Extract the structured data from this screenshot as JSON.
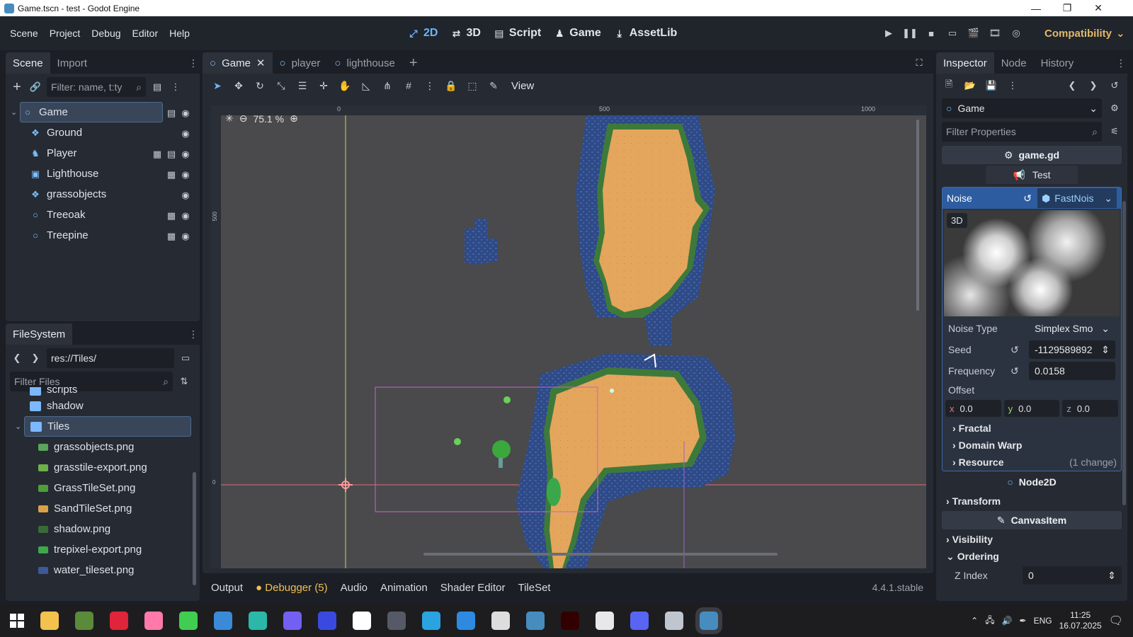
{
  "window": {
    "title": "Game.tscn - test - Godot Engine",
    "min": "—",
    "max": "❐",
    "close": "✕"
  },
  "menu": [
    "Scene",
    "Project",
    "Debug",
    "Editor",
    "Help"
  ],
  "workspaces": [
    {
      "label": "2D",
      "icon": "2d-icon",
      "glyph": "⤢",
      "active": true
    },
    {
      "label": "3D",
      "icon": "3d-icon",
      "glyph": "⇄",
      "active": false
    },
    {
      "label": "Script",
      "icon": "script-icon",
      "glyph": "▤",
      "active": false
    },
    {
      "label": "Game",
      "icon": "game-icon",
      "glyph": "♟",
      "active": false
    },
    {
      "label": "AssetLib",
      "icon": "assetlib-icon",
      "glyph": "⤓",
      "active": false
    }
  ],
  "renderer": "Compatibility",
  "scene_dock": {
    "tabs": [
      "Scene",
      "Import"
    ],
    "filter_placeholder": "Filter: name, t:ty",
    "nodes": [
      {
        "name": "Game",
        "depth": 0,
        "icon": "node2d-icon",
        "glyph": "○",
        "script": true,
        "movie": false,
        "selected": true
      },
      {
        "name": "Ground",
        "depth": 1,
        "icon": "tilemap-icon",
        "glyph": "❖",
        "script": false,
        "movie": false,
        "selected": false
      },
      {
        "name": "Player",
        "depth": 1,
        "icon": "character-icon",
        "glyph": "♞",
        "script": true,
        "movie": true,
        "selected": false
      },
      {
        "name": "Lighthouse",
        "depth": 1,
        "icon": "static-body-icon",
        "glyph": "▣",
        "script": false,
        "movie": true,
        "selected": false
      },
      {
        "name": "grassobjects",
        "depth": 1,
        "icon": "tilemap-icon",
        "glyph": "❖",
        "script": false,
        "movie": false,
        "selected": false
      },
      {
        "name": "Treeoak",
        "depth": 1,
        "icon": "node2d-icon",
        "glyph": "○",
        "script": false,
        "movie": true,
        "selected": false
      },
      {
        "name": "Treepine",
        "depth": 1,
        "icon": "node2d-icon",
        "glyph": "○",
        "script": false,
        "movie": true,
        "selected": false
      }
    ]
  },
  "filesystem": {
    "tab": "FileSystem",
    "path": "res://Tiles/",
    "filter_placeholder": "Filter Files",
    "items": [
      {
        "name": "scripts",
        "type": "folder",
        "depth": 0,
        "selected": false,
        "color": "#7cb8ff"
      },
      {
        "name": "shadow",
        "type": "folder",
        "depth": 0,
        "selected": false,
        "color": "#7cb8ff"
      },
      {
        "name": "Tiles",
        "type": "folder",
        "depth": 0,
        "selected": true,
        "color": "#7cb8ff"
      },
      {
        "name": "grassobjects.png",
        "type": "file",
        "depth": 1,
        "selected": false,
        "color": "#5aa55a"
      },
      {
        "name": "grasstile-export.png",
        "type": "file",
        "depth": 1,
        "selected": false,
        "color": "#6fb04a"
      },
      {
        "name": "GrassTileSet.png",
        "type": "file",
        "depth": 1,
        "selected": false,
        "color": "#4e9e3a"
      },
      {
        "name": "SandTileSet.png",
        "type": "file",
        "depth": 1,
        "selected": false,
        "color": "#d9a24a"
      },
      {
        "name": "shadow.png",
        "type": "file",
        "depth": 1,
        "selected": false,
        "color": "#3a6a3a"
      },
      {
        "name": "trepixel-export.png",
        "type": "file",
        "depth": 1,
        "selected": false,
        "color": "#3da84a"
      },
      {
        "name": "water_tileset.png",
        "type": "file",
        "depth": 1,
        "selected": false,
        "color": "#3a5a9a"
      }
    ]
  },
  "viewport": {
    "tabs": [
      {
        "label": "Game",
        "active": true,
        "closable": true
      },
      {
        "label": "player",
        "active": false,
        "closable": false
      },
      {
        "label": "lighthouse",
        "active": false,
        "closable": false
      }
    ],
    "view_menu": "View",
    "zoom": "75.1 %",
    "ruler_h": [
      "0",
      "500",
      "1000"
    ],
    "ruler_v": [
      "500",
      "0"
    ]
  },
  "bottom_tabs": [
    "Output",
    "Debugger (5)",
    "Audio",
    "Animation",
    "Shader Editor",
    "TileSet"
  ],
  "version": "4.4.1.stable",
  "inspector": {
    "tabs": [
      "Inspector",
      "Node",
      "History"
    ],
    "object": "Game",
    "filter_placeholder": "Filter Properties",
    "script": "game.gd",
    "category_test": "Test",
    "noise_label": "Noise",
    "noise_resource": "FastNois",
    "preview_badge": "3D",
    "noise_type_label": "Noise Type",
    "noise_type_value": "Simplex Smo",
    "seed_label": "Seed",
    "seed_value": "-1129589892",
    "frequency_label": "Frequency",
    "frequency_value": "0.0158",
    "offset_label": "Offset",
    "offset": [
      {
        "axis": "x",
        "value": "0.0"
      },
      {
        "axis": "y",
        "value": "0.0"
      },
      {
        "axis": "z",
        "value": "0.0"
      }
    ],
    "sections": [
      "Fractal",
      "Domain Warp"
    ],
    "resource_label": "Resource",
    "resource_note": "(1 change)",
    "node2d_header": "Node2D",
    "transform_label": "Transform",
    "canvasitem_header": "CanvasItem",
    "visibility_label": "Visibility",
    "ordering_label": "Ordering",
    "zindex_label": "Z Index",
    "zindex_value": "0"
  },
  "taskbar": {
    "apps": [
      {
        "icon": "explorer-icon",
        "color": "#f2c14e"
      },
      {
        "icon": "minecraft-icon",
        "color": "#5a8a3a"
      },
      {
        "icon": "opera-icon",
        "color": "#e0243a"
      },
      {
        "icon": "paint-icon",
        "color": "#ff7aa8"
      },
      {
        "icon": "qt-icon",
        "color": "#41cd52"
      },
      {
        "icon": "krita-icon",
        "color": "#3a8ad8"
      },
      {
        "icon": "nextcloud-icon",
        "color": "#2bb8a8"
      },
      {
        "icon": "viber-icon",
        "color": "#7360f2"
      },
      {
        "icon": "app-icon",
        "color": "#3a4ae0"
      },
      {
        "icon": "capcut-icon",
        "color": "#ffffff"
      },
      {
        "icon": "obs-icon",
        "color": "#555a66"
      },
      {
        "icon": "telegram-icon",
        "color": "#2aa3e0"
      },
      {
        "icon": "vscode-icon",
        "color": "#2d8ae0"
      },
      {
        "icon": "inkscape-icon",
        "color": "#dddddd"
      },
      {
        "icon": "godot-icon",
        "color": "#478cbf"
      },
      {
        "icon": "illustrator-icon",
        "color": "#330000"
      },
      {
        "icon": "twitch-icon",
        "color": "#e8e8e8"
      },
      {
        "icon": "discord-icon",
        "color": "#5865f2"
      },
      {
        "icon": "files-icon",
        "color": "#c0c6d0"
      },
      {
        "icon": "godot-active-icon",
        "color": "#478cbf"
      }
    ],
    "lang": "ENG",
    "time": "11:25",
    "date": "16.07.2025"
  }
}
